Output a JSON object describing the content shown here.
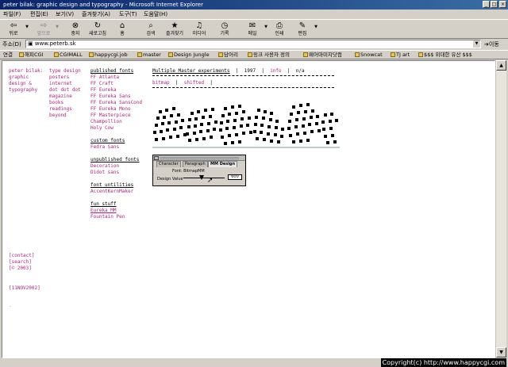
{
  "window": {
    "title": "peter bilak: graphic design and typography - Microsoft Internet Explorer"
  },
  "menu": [
    "파일(F)",
    "편집(E)",
    "보기(V)",
    "즐겨찾기(A)",
    "도구(T)",
    "도움말(H)"
  ],
  "toolbar": {
    "back": "뒤로",
    "forward": "앞으로",
    "stop": "중지",
    "refresh": "새로고침",
    "home": "홈",
    "search": "검색",
    "favorites": "즐겨찾기",
    "media": "미디어",
    "history": "기록",
    "mail": "메일",
    "print": "인쇄",
    "edit": "편집"
  },
  "address": {
    "label": "주소(D)",
    "value": "www.peterb.sk",
    "go": "이동"
  },
  "links": {
    "label": "연결",
    "items": [
      "해피CGI",
      "CGIMALL",
      "happycgi.job",
      "master",
      "Design Jungle",
      "담어리",
      "링크 사용자 정의",
      "웨어마미지닷컴",
      "Snowcat",
      "TJ art",
      "$$$ 위대한 유산 $$$"
    ]
  },
  "page": {
    "nav1": [
      "peter bilak:",
      "graphic",
      "design &",
      "typography"
    ],
    "nav2": [
      "type design",
      "posters",
      "internet",
      "dot dot dot",
      "magazine",
      "books",
      "readings",
      "beyond"
    ],
    "published_heading": "published fonts",
    "published": [
      "FF Atlanta",
      "FF Craft",
      "FF Eureka",
      "FF Eureka Sans",
      "FF Eureka SansCond",
      "FF Eureka Mono",
      "FF Masterpiece",
      "Champollion",
      "Holy Cow"
    ],
    "custom_heading": "custom fonts",
    "custom": [
      "Fedra Sans"
    ],
    "unpublished_heading": "unpublished fonts",
    "unpublished": [
      "Decoration",
      "Didot sans"
    ],
    "utilities_heading": "font untilities",
    "utilities": [
      "AccentKernMaker"
    ],
    "fun_heading": "fun stuff",
    "fun": [
      "Eureka MM",
      "Fountain Pen"
    ],
    "bottom_links": [
      "[contact]",
      "[search]",
      "[© 2003]"
    ],
    "datestamp": "[11NOV2002]",
    "dot": ".",
    "experiment": {
      "title": "Multiple Master experiments",
      "sep1": "|",
      "year": "1997",
      "sep2": "|",
      "info": "info",
      "sep3": "|",
      "na": "n/a",
      "bitmap": "bitmap",
      "sep4": "|",
      "shifted": "shifted",
      "sep5": "|"
    },
    "dialog": {
      "tabs": [
        "Character",
        "Paragraph",
        "MM Design"
      ],
      "font_label": "Font: BitmapMM",
      "design_label": "Design Value",
      "design_value": "600",
      "slider_level": 0.45
    }
  },
  "status": {
    "copyright": "Copyright(c) http://www.happycgi.com"
  }
}
